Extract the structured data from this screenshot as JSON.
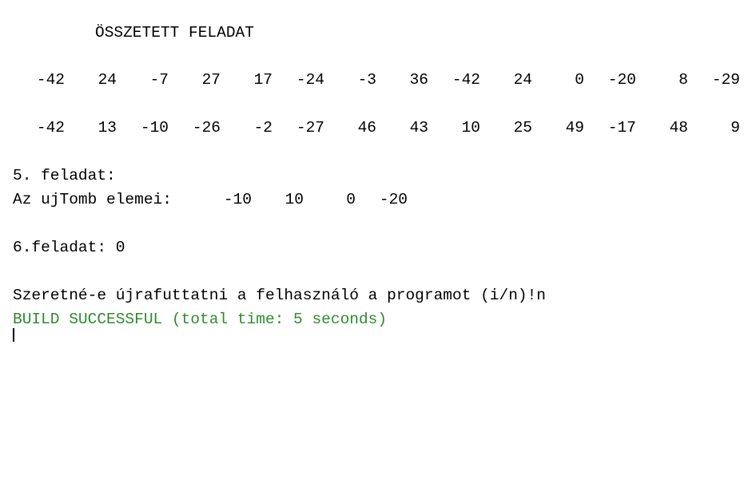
{
  "console": {
    "title_line": "ÖSSZETETT FELADAT",
    "row1": [
      "-42",
      "24",
      "-7",
      "27",
      "17",
      "-24",
      "-3",
      "36",
      "-42",
      "24",
      "0",
      "-20",
      "8",
      "-29"
    ],
    "row2": [
      "-42",
      "13",
      "-10",
      "-26",
      "-2",
      "-27",
      "46",
      "43",
      "10",
      "25",
      "49",
      "-17",
      "48",
      "9"
    ],
    "task5_heading": "5. feladat:",
    "task5_label": "Az ujTomb elemei:",
    "task5_values": [
      "-10",
      "10",
      "0",
      "-20"
    ],
    "task6_line": "6.feladat: 0",
    "prompt_line": "Szeretné-e újrafuttatni a felhasználó a programot (i/n)!n",
    "build_line": "BUILD SUCCESSFUL (total time: 5 seconds)",
    "build_color": "#2e8b2e"
  }
}
